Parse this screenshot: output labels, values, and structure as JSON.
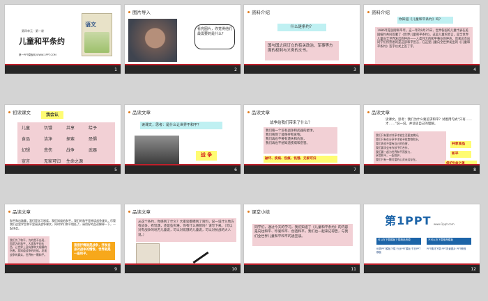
{
  "slides": [
    {
      "num": "1",
      "unit": "第四单元 · 第一课",
      "title": "儿童和平条约",
      "book": "语文",
      "site": "第一PPT模板网-WWW.1PPT.COM"
    },
    {
      "num": "2",
      "tag": "图片导入",
      "bubble": "看完图片，你觉得他们最需要的是什么？"
    },
    {
      "num": "3",
      "tag": "资料介绍",
      "heading": "什么是条约？",
      "text": "国与国之间订立的有关政治、军事等方面的权利与义务的文书。"
    },
    {
      "num": "4",
      "tag": "资料介绍",
      "heading": "你知道《儿童和平条约》吗？",
      "text": "1986年是国际和平年。这一年的9月25日，世界各国的儿童代表在美国纽约共同签署了《世界儿童和平条约》。这是儿童的宣言，是全世界儿童向全世界发出的呼声——人类伟大的和平事业的呼声。后来这市向同学们所熟悉的是这部和平宣言，在这里儿童向全世界发出的《儿童和平条约》签字仪式上签了字。"
    },
    {
      "num": "5",
      "tag": "初读课文",
      "heading": "我会认",
      "rows": [
        [
          "儿童",
          "饥饿",
          "共享",
          "给予"
        ],
        [
          "食品",
          "洁净",
          "探索",
          "恐惧"
        ],
        [
          "幻想",
          "悲伤",
          "战争",
          "武器"
        ],
        [
          "宣言",
          "无家可归",
          "生命之源"
        ]
      ]
    },
    {
      "num": "6",
      "tag": "品读文章",
      "question": "读课文，思考：是什么让世界不和平？",
      "answer": "战 争"
    },
    {
      "num": "7",
      "tag": "品读文章",
      "heading": "战争给我们带来了什么？",
      "lines": [
        "我们看一个没有战争和武器的星球，",
        "我们看到了能保存和食物。",
        "我们再也不要有遗失和仇恨，",
        "我们再也不想知道疾病和伤害。"
      ],
      "answer": "破坏、疾病、伤痕、饥饿、无家可归"
    },
    {
      "num": "8",
      "tag": "品读文章",
      "question": "读课文，思考：我们为什么要追求和平？试着用句式“只有……才……”说一说，并谈谈自己的理解。",
      "lines": [
        "我们只有要对共享才能生活更加美好，",
        "我们只有在分享中才能寻找食物和水，",
        "我们再也不要有自己的伤害，",
        "我们要学会有作孩子们合作，",
        "我们要一起为世界和平而努力，",
        "享受和平，一起保护，",
        "我们只有一颗可爱的心灵永远存在。"
      ],
      "tags": [
        "共享食品",
        "和平",
        "保护生命之源"
      ]
    },
    {
      "num": "9",
      "tag": "品读文章",
      "intro": "和平和出路童，我们是学习阅读，我们知道的和平，我们的和平里阅读战争课文，尽管我们这里学生和平里阅读战争课文，同时学们和平相处了，请用好的品读解释一下，一起体会。",
      "poem": "我们为了和平，为的是不出现，而是为的和平，大家和平的东西，让世界上没有那种大规模的伤害，我知道战争的时候，发现战争的真实，世界有一颗和平。",
      "answer": "直接抒情就是战争，抒发自身对战争的憎恨，世界就是一座和平。"
    },
    {
      "num": "10",
      "tag": "品读文章",
      "text": "从这个条约，你感到了什么？大家谈都摸到了资料，说一说什么地方有战争，有饥饿，还是些灾难，你有什么感想吗？请写下来。（可以对有战争的地方儿童说，可以对饥饿的儿童说，可以对抗战的大人说。）"
    },
    {
      "num": "11",
      "tag": "课堂小结",
      "text": "同学们，通过今天的学习，我们知道了《儿童和平条约》的内容是向往和平、珍爱和平、创造和平，我们也一起来记得告，与我们全世界儿童和平和平的通宣读。"
    },
    {
      "num": "12",
      "logo_main": "第1PPT",
      "logo_sub": "www.1ppt.com",
      "left_head": "可以在下载模板下载精品资源",
      "right_head": "不可以在下载推荐模板",
      "left_note": "优秀PPT模板下载  行业PPT模板  节日PPT模板",
      "right_note": "PPT素材下载  PPT背景图片  PPT教程"
    }
  ]
}
